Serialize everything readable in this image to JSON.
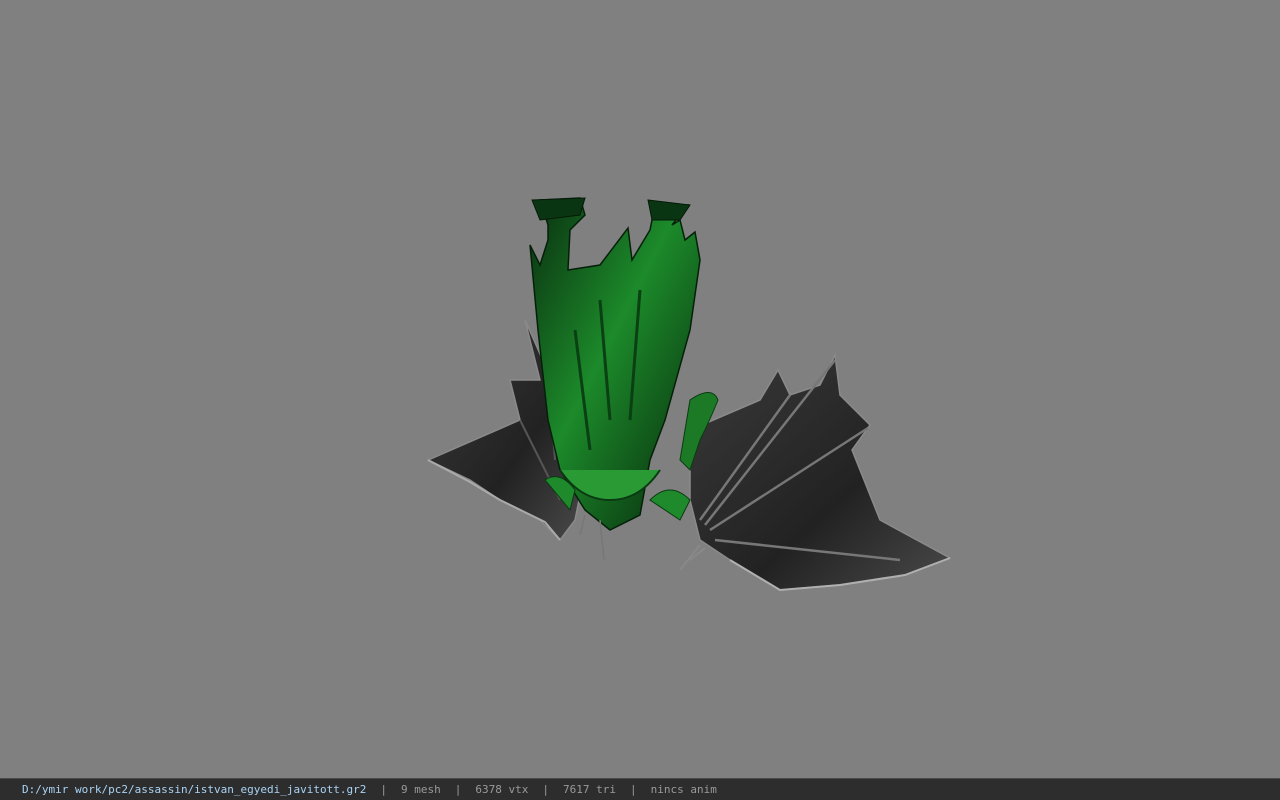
{
  "status_bar": {
    "file_path": "D:/ymir work/pc2/assassin/istvan_egyedi_javitott.gr2",
    "mesh_count": "9 mesh",
    "vertex_count": "6378 vtx",
    "triangle_count": "7617 tri",
    "animation": "nincs anim",
    "separator": "|"
  },
  "model": {
    "description_icon": "model-preview",
    "colors": {
      "background": "#808080",
      "armor_green": "#1f8a2c",
      "armor_dark_green": "#0b3b12",
      "wing_dark": "#2b2b2b",
      "wing_edge": "#9a9a9a"
    }
  }
}
